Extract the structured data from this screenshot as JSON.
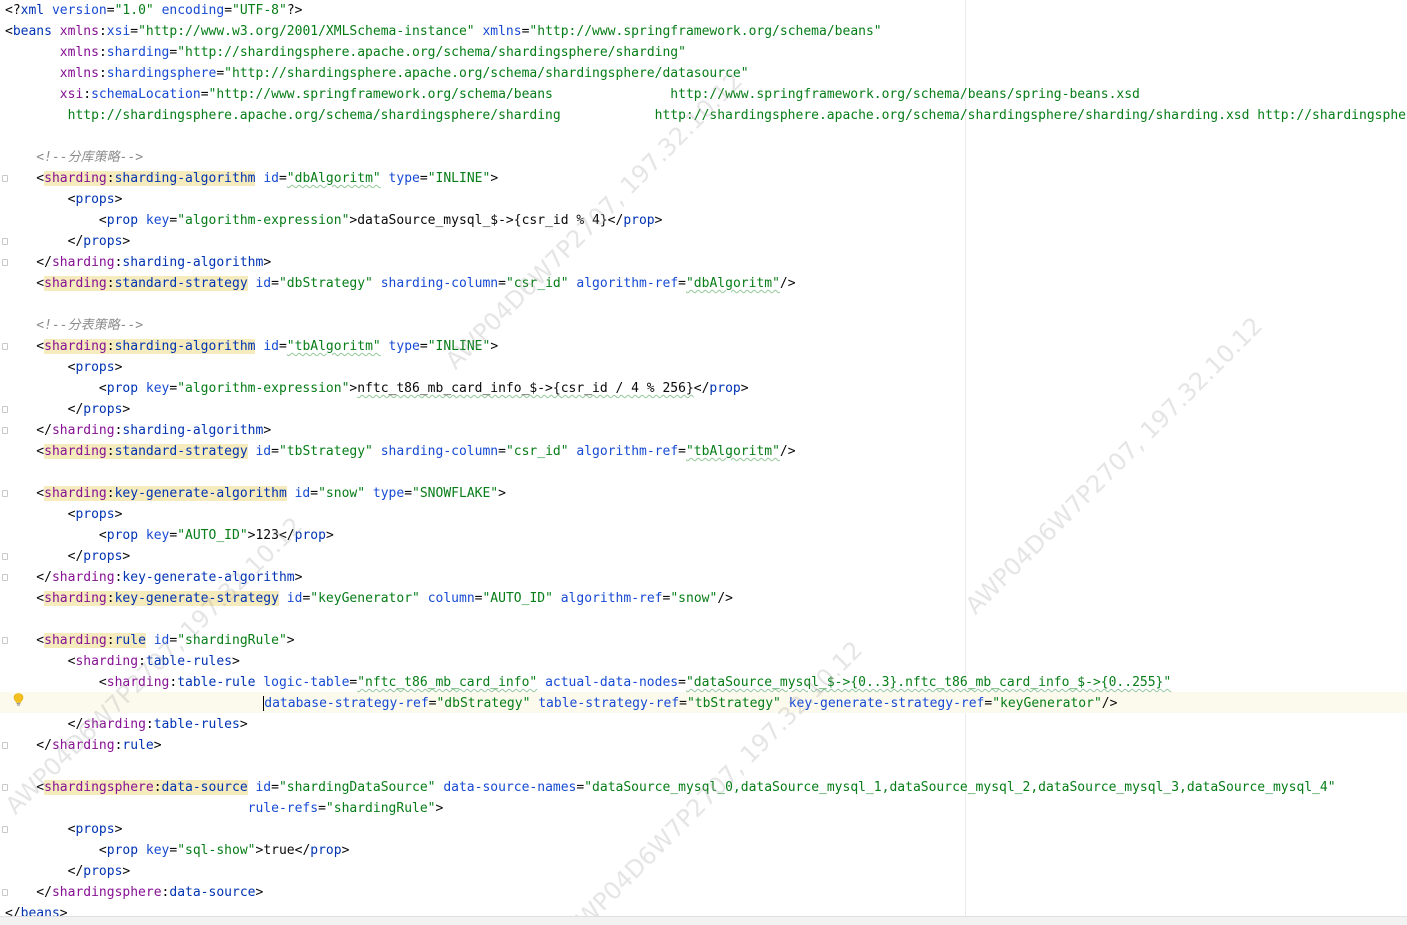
{
  "editor": {
    "lines": [
      [
        [
          "p",
          "<?"
        ],
        [
          "t",
          "xml "
        ],
        [
          "a",
          "version"
        ],
        [
          "p",
          "="
        ],
        [
          "s",
          "\"1.0\""
        ],
        [
          "p",
          " "
        ],
        [
          "a",
          "encoding"
        ],
        [
          "p",
          "="
        ],
        [
          "s",
          "\"UTF-8\""
        ],
        [
          "p",
          "?>"
        ]
      ],
      [
        [
          "p",
          "<"
        ],
        [
          "t",
          "beans "
        ],
        [
          "n",
          "xmlns"
        ],
        [
          "p",
          ":"
        ],
        [
          "a",
          "xsi"
        ],
        [
          "p",
          "="
        ],
        [
          "s",
          "\"http://www.w3.org/2001/XMLSchema-instance\""
        ],
        [
          "p",
          " "
        ],
        [
          "a",
          "xmlns"
        ],
        [
          "p",
          "="
        ],
        [
          "s",
          "\"http://www.springframework.org/schema/beans\""
        ]
      ],
      [
        [
          "p",
          "       "
        ],
        [
          "n",
          "xmlns"
        ],
        [
          "p",
          ":"
        ],
        [
          "a",
          "sharding"
        ],
        [
          "p",
          "="
        ],
        [
          "s",
          "\"http://shardingsphere.apache.org/schema/shardingsphere/sharding\""
        ]
      ],
      [
        [
          "p",
          "       "
        ],
        [
          "n",
          "xmlns"
        ],
        [
          "p",
          ":"
        ],
        [
          "a",
          "shardingsphere"
        ],
        [
          "p",
          "="
        ],
        [
          "s",
          "\"http://shardingsphere.apache.org/schema/shardingsphere/datasource\""
        ]
      ],
      [
        [
          "p",
          "       "
        ],
        [
          "n",
          "xsi"
        ],
        [
          "p",
          ":"
        ],
        [
          "a",
          "schemaLocation"
        ],
        [
          "p",
          "="
        ],
        [
          "s",
          "\"http://www.springframework.org/schema/beans               http://www.springframework.org/schema/beans/spring-beans.xsd"
        ]
      ],
      [
        [
          "s",
          "        http://shardingsphere.apache.org/schema/shardingsphere/sharding            http://shardingsphere.apache.org/schema/shardingsphere/sharding/sharding.xsd http://shardingsphere"
        ]
      ],
      [],
      [
        [
          "c",
          "    <!--分库策略-->"
        ]
      ],
      [
        [
          "p",
          "    <"
        ],
        [
          "H",
          "sharding:sharding-algorithm"
        ],
        [
          "p",
          " "
        ],
        [
          "a",
          "id"
        ],
        [
          "p",
          "="
        ],
        [
          "s",
          "\"dbAlgoritm\""
        ],
        [
          "p",
          " "
        ],
        [
          "a",
          "type"
        ],
        [
          "p",
          "="
        ],
        [
          "s",
          "\"INLINE\""
        ],
        [
          "p",
          ">"
        ]
      ],
      [
        [
          "p",
          "        <"
        ],
        [
          "t",
          "props"
        ],
        [
          "p",
          ">"
        ]
      ],
      [
        [
          "p",
          "            <"
        ],
        [
          "t",
          "prop "
        ],
        [
          "a",
          "key"
        ],
        [
          "p",
          "="
        ],
        [
          "s",
          "\"algorithm-expression\""
        ],
        [
          "p",
          ">"
        ],
        [
          "x",
          "dataSource_mysql_$->{csr_id % 4}"
        ],
        [
          "p",
          "</"
        ],
        [
          "t",
          "prop"
        ],
        [
          "p",
          ">"
        ]
      ],
      [
        [
          "p",
          "        </"
        ],
        [
          "t",
          "props"
        ],
        [
          "p",
          ">"
        ]
      ],
      [
        [
          "p",
          "    </"
        ],
        [
          "n",
          "sharding"
        ],
        [
          "p",
          ":"
        ],
        [
          "t",
          "sharding-algorithm"
        ],
        [
          "p",
          ">"
        ]
      ],
      [
        [
          "p",
          "    <"
        ],
        [
          "H",
          "sharding:standard-strategy"
        ],
        [
          "p",
          " "
        ],
        [
          "a",
          "id"
        ],
        [
          "p",
          "="
        ],
        [
          "s",
          "\"dbStrategy\""
        ],
        [
          "p",
          " "
        ],
        [
          "a",
          "sharding-column"
        ],
        [
          "p",
          "="
        ],
        [
          "s",
          "\"csr_id\""
        ],
        [
          "p",
          " "
        ],
        [
          "a",
          "algorithm-ref"
        ],
        [
          "p",
          "="
        ],
        [
          "s",
          "\"dbAlgoritm\""
        ],
        [
          "p",
          "/>"
        ]
      ],
      [],
      [
        [
          "c",
          "    <!--分表策略-->"
        ]
      ],
      [
        [
          "p",
          "    <"
        ],
        [
          "H",
          "sharding:sharding-algorithm"
        ],
        [
          "p",
          " "
        ],
        [
          "a",
          "id"
        ],
        [
          "p",
          "="
        ],
        [
          "s",
          "\"tbAlgoritm\""
        ],
        [
          "p",
          " "
        ],
        [
          "a",
          "type"
        ],
        [
          "p",
          "="
        ],
        [
          "s",
          "\"INLINE\""
        ],
        [
          "p",
          ">"
        ]
      ],
      [
        [
          "p",
          "        <"
        ],
        [
          "t",
          "props"
        ],
        [
          "p",
          ">"
        ]
      ],
      [
        [
          "p",
          "            <"
        ],
        [
          "t",
          "prop "
        ],
        [
          "a",
          "key"
        ],
        [
          "p",
          "="
        ],
        [
          "s",
          "\"algorithm-expression\""
        ],
        [
          "p",
          ">"
        ],
        [
          "x",
          "nftc_t86_mb_card_info_$->{csr_id / 4 % 256}"
        ],
        [
          "p",
          "</"
        ],
        [
          "t",
          "prop"
        ],
        [
          "p",
          ">"
        ]
      ],
      [
        [
          "p",
          "        </"
        ],
        [
          "t",
          "props"
        ],
        [
          "p",
          ">"
        ]
      ],
      [
        [
          "p",
          "    </"
        ],
        [
          "n",
          "sharding"
        ],
        [
          "p",
          ":"
        ],
        [
          "t",
          "sharding-algorithm"
        ],
        [
          "p",
          ">"
        ]
      ],
      [
        [
          "p",
          "    <"
        ],
        [
          "H",
          "sharding:standard-strategy"
        ],
        [
          "p",
          " "
        ],
        [
          "a",
          "id"
        ],
        [
          "p",
          "="
        ],
        [
          "s",
          "\"tbStrategy\""
        ],
        [
          "p",
          " "
        ],
        [
          "a",
          "sharding-column"
        ],
        [
          "p",
          "="
        ],
        [
          "s",
          "\"csr_id\""
        ],
        [
          "p",
          " "
        ],
        [
          "a",
          "algorithm-ref"
        ],
        [
          "p",
          "="
        ],
        [
          "s",
          "\"tbAlgoritm\""
        ],
        [
          "p",
          "/>"
        ]
      ],
      [],
      [
        [
          "p",
          "    <"
        ],
        [
          "H",
          "sharding:key-generate-algorithm"
        ],
        [
          "p",
          " "
        ],
        [
          "a",
          "id"
        ],
        [
          "p",
          "="
        ],
        [
          "s",
          "\"snow\""
        ],
        [
          "p",
          " "
        ],
        [
          "a",
          "type"
        ],
        [
          "p",
          "="
        ],
        [
          "s",
          "\"SNOWFLAKE\""
        ],
        [
          "p",
          ">"
        ]
      ],
      [
        [
          "p",
          "        <"
        ],
        [
          "t",
          "props"
        ],
        [
          "p",
          ">"
        ]
      ],
      [
        [
          "p",
          "            <"
        ],
        [
          "t",
          "prop "
        ],
        [
          "a",
          "key"
        ],
        [
          "p",
          "="
        ],
        [
          "s",
          "\"AUTO_ID\""
        ],
        [
          "p",
          ">"
        ],
        [
          "x",
          "123"
        ],
        [
          "p",
          "</"
        ],
        [
          "t",
          "prop"
        ],
        [
          "p",
          ">"
        ]
      ],
      [
        [
          "p",
          "        </"
        ],
        [
          "t",
          "props"
        ],
        [
          "p",
          ">"
        ]
      ],
      [
        [
          "p",
          "    </"
        ],
        [
          "n",
          "sharding"
        ],
        [
          "p",
          ":"
        ],
        [
          "t",
          "key-generate-algorithm"
        ],
        [
          "p",
          ">"
        ]
      ],
      [
        [
          "p",
          "    <"
        ],
        [
          "H",
          "sharding:key-generate-strategy"
        ],
        [
          "p",
          " "
        ],
        [
          "a",
          "id"
        ],
        [
          "p",
          "="
        ],
        [
          "s",
          "\"keyGenerator\""
        ],
        [
          "p",
          " "
        ],
        [
          "a",
          "column"
        ],
        [
          "p",
          "="
        ],
        [
          "s",
          "\"AUTO_ID\""
        ],
        [
          "p",
          " "
        ],
        [
          "a",
          "algorithm-ref"
        ],
        [
          "p",
          "="
        ],
        [
          "s",
          "\"snow\""
        ],
        [
          "p",
          "/>"
        ]
      ],
      [],
      [
        [
          "p",
          "    <"
        ],
        [
          "H",
          "sharding:rule"
        ],
        [
          "p",
          " "
        ],
        [
          "a",
          "id"
        ],
        [
          "p",
          "="
        ],
        [
          "s",
          "\"shardingRule\""
        ],
        [
          "p",
          ">"
        ]
      ],
      [
        [
          "p",
          "        <"
        ],
        [
          "n",
          "sharding"
        ],
        [
          "p",
          ":"
        ],
        [
          "t",
          "table-rules"
        ],
        [
          "p",
          ">"
        ]
      ],
      [
        [
          "p",
          "            <"
        ],
        [
          "n",
          "sharding"
        ],
        [
          "p",
          ":"
        ],
        [
          "t",
          "table-rule "
        ],
        [
          "a",
          "logic-table"
        ],
        [
          "p",
          "="
        ],
        [
          "s",
          "\"nftc_t86_mb_card_info\""
        ],
        [
          "p",
          " "
        ],
        [
          "a",
          "actual-data-nodes"
        ],
        [
          "p",
          "="
        ],
        [
          "s",
          "\"dataSource_mysql_$->{0..3}.nftc_t86_mb_card_info_$->{0..255}\""
        ]
      ],
      [
        [
          "p",
          "                                 "
        ],
        [
          "K",
          ""
        ],
        [
          "a",
          "database-strategy-ref"
        ],
        [
          "p",
          "="
        ],
        [
          "s",
          "\"dbStrategy\""
        ],
        [
          "p",
          " "
        ],
        [
          "a",
          "table-strategy-ref"
        ],
        [
          "p",
          "="
        ],
        [
          "s",
          "\"tbStrategy\""
        ],
        [
          "p",
          " "
        ],
        [
          "a",
          "key-generate-strategy-ref"
        ],
        [
          "p",
          "="
        ],
        [
          "s",
          "\"keyGenerator\""
        ],
        [
          "p",
          "/>"
        ]
      ],
      [
        [
          "p",
          "        </"
        ],
        [
          "n",
          "sharding"
        ],
        [
          "p",
          ":"
        ],
        [
          "t",
          "table-rules"
        ],
        [
          "p",
          ">"
        ]
      ],
      [
        [
          "p",
          "    </"
        ],
        [
          "n",
          "sharding"
        ],
        [
          "p",
          ":"
        ],
        [
          "t",
          "rule"
        ],
        [
          "p",
          ">"
        ]
      ],
      [],
      [
        [
          "p",
          "    <"
        ],
        [
          "H",
          "shardingsphere:data-source"
        ],
        [
          "p",
          " "
        ],
        [
          "a",
          "id"
        ],
        [
          "p",
          "="
        ],
        [
          "s",
          "\"shardingDataSource\""
        ],
        [
          "p",
          " "
        ],
        [
          "a",
          "data-source-names"
        ],
        [
          "p",
          "="
        ],
        [
          "s",
          "\"dataSource_mysql_0,dataSource_mysql_1,dataSource_mysql_2,dataSource_mysql_3,dataSource_mysql_4\""
        ]
      ],
      [
        [
          "p",
          "                               "
        ],
        [
          "a",
          "rule-refs"
        ],
        [
          "p",
          "="
        ],
        [
          "s",
          "\"shardingRule\""
        ],
        [
          "p",
          ">"
        ]
      ],
      [
        [
          "p",
          "        <"
        ],
        [
          "t",
          "props"
        ],
        [
          "p",
          ">"
        ]
      ],
      [
        [
          "p",
          "            <"
        ],
        [
          "t",
          "prop "
        ],
        [
          "a",
          "key"
        ],
        [
          "p",
          "="
        ],
        [
          "s",
          "\"sql-show\""
        ],
        [
          "p",
          ">"
        ],
        [
          "x",
          "true"
        ],
        [
          "p",
          "</"
        ],
        [
          "t",
          "prop"
        ],
        [
          "p",
          ">"
        ]
      ],
      [
        [
          "p",
          "        </"
        ],
        [
          "t",
          "props"
        ],
        [
          "p",
          ">"
        ]
      ],
      [
        [
          "p",
          "    </"
        ],
        [
          "n",
          "shardingsphere"
        ],
        [
          "p",
          ":"
        ],
        [
          "t",
          "data-source"
        ],
        [
          "p",
          ">"
        ]
      ],
      [
        [
          "p",
          "</"
        ],
        [
          "t",
          "beans"
        ],
        [
          "p",
          ">"
        ]
      ]
    ]
  },
  "watermarks": [
    "AWP04D6W7P2707, 197.32.10.12",
    "AWP04D6W7P2707, 197.32.10.12",
    "AWP04D6W7P2707, 197.32.10.12",
    "AWP04D6W7P2707, 197.32.10.12"
  ],
  "icons": {
    "gutter_hint": "lightbulb-icon",
    "fold": "fold-marker-icon"
  },
  "colors": {
    "tag": "#0033b3",
    "namespace": "#871094",
    "attribute": "#174ad4",
    "string": "#067d17",
    "comment": "#8c8c8c",
    "tag_highlight": "#f6ebbc",
    "caret_row": "#fcfaed"
  }
}
